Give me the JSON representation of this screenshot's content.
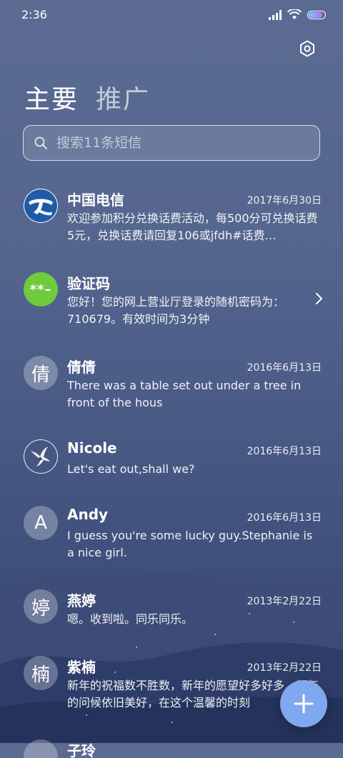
{
  "status_bar": {
    "time": "2:36",
    "battery_level": 0.8,
    "signal_bars": 4
  },
  "header": {
    "settings_icon": "gear-icon",
    "tabs": [
      {
        "label": "主要",
        "active": true
      },
      {
        "label": "推广",
        "active": false
      }
    ]
  },
  "search": {
    "placeholder": "搜索11条短信",
    "icon": "search-icon"
  },
  "conversations": [
    {
      "name": "中国电信",
      "date": "2017年6月30日",
      "snippet": "欢迎参加积分兑换话费活动，每500分可兑换话费5元，兑换话费请回复106或jfdh#话费…",
      "avatar_type": "telecom-logo"
    },
    {
      "name": "验证码",
      "date": "",
      "snippet": "您好！您的网上营业厅登录的随机密码为：710679。有效时间为3分钟",
      "avatar_type": "code",
      "avatar_text": "**–"
    },
    {
      "name": "倩倩",
      "date": "2016年6月13日",
      "snippet": "There was a table set out under a tree in front of the hous",
      "avatar_type": "initial",
      "avatar_text": "倩"
    },
    {
      "name": "Nicole",
      "date": "2016年6月13日",
      "snippet": "Let's eat out,shall we?",
      "avatar_type": "bird-photo"
    },
    {
      "name": "Andy",
      "date": "2016年6月13日",
      "snippet": "I guess you're some lucky guy.Stephanie is a nice girl.",
      "avatar_type": "initial",
      "avatar_text": "A"
    },
    {
      "name": "燕婷",
      "date": "2013年2月22日",
      "snippet": "嗯。收到啦。同乐同乐。",
      "avatar_type": "initial",
      "avatar_text": "婷"
    },
    {
      "name": "紫楠",
      "date": "2013年2月22日",
      "snippet": "新年的祝福数不胜数，新年的愿望好多好多，新年的问候依旧美好，在这个温馨的时刻",
      "avatar_type": "initial",
      "avatar_text": "楠"
    },
    {
      "name": "子玲",
      "date": "",
      "snippet": "",
      "avatar_type": "initial",
      "avatar_text": ""
    }
  ],
  "fab": {
    "icon": "plus-icon"
  },
  "colors": {
    "fab": "#7fa8ee",
    "code_avatar": "#6fcb3e",
    "telecom_blue": "#1e5ca8"
  }
}
